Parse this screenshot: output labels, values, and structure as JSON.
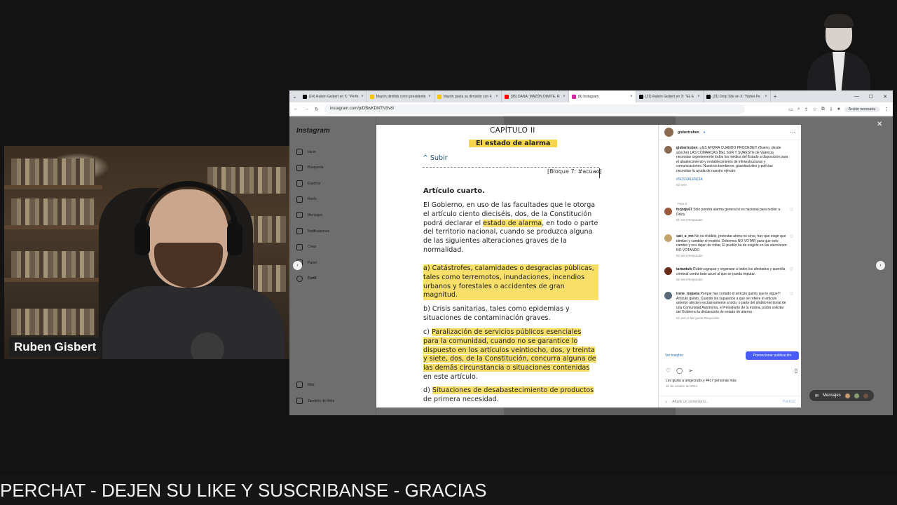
{
  "webcam": {
    "name": "Ruben Gisbert"
  },
  "ticker": {
    "text": "PERCHAT - DEJEN SU LIKE Y SUSCRIBANSE - GRACIAS"
  },
  "browser": {
    "tabs": [
      {
        "label": "(14) Rubén Gisbert en X: \"Perfe",
        "color": "#000000",
        "icon": "x-icon"
      },
      {
        "label": "Mazón dimitirá como presidente",
        "color": "#f5c400",
        "icon": "news-icon"
      },
      {
        "label": "Mazón pacta su dimisión con F",
        "color": "#f5c400",
        "icon": "news-icon"
      },
      {
        "label": "(95) DANA: MAZÓN DIMITE. R",
        "color": "#ff0000",
        "icon": "youtube-icon"
      },
      {
        "label": "(8) Instagram",
        "color": "#d6249f",
        "icon": "instagram-icon"
      },
      {
        "label": "(21) Rubén Gisbert en X: \"EL E",
        "color": "#000000",
        "icon": "x-icon"
      },
      {
        "label": "(21) Drop Site en X: \"Nobel Pe",
        "color": "#000000",
        "icon": "x-icon"
      }
    ],
    "active_tab": 4,
    "url": "instagram.com/p/DBwKDNTNSv8/",
    "accion": "Acción necesaria"
  },
  "instagram": {
    "logo": "Instagram",
    "nav": [
      {
        "label": "Inicio",
        "icon": "home-icon"
      },
      {
        "label": "Búsqueda",
        "icon": "search-icon"
      },
      {
        "label": "Explorar",
        "icon": "compass-icon"
      },
      {
        "label": "Reels",
        "icon": "reels-icon"
      },
      {
        "label": "Mensajes",
        "icon": "messenger-icon"
      },
      {
        "label": "Notificaciones",
        "icon": "heart-icon"
      },
      {
        "label": "Crear",
        "icon": "plus-icon"
      },
      {
        "label": "Panel",
        "icon": "chart-icon"
      },
      {
        "label": "Perfil",
        "icon": "avatar-icon"
      }
    ],
    "nav_bottom": [
      {
        "label": "Más",
        "icon": "menu-icon"
      },
      {
        "label": "También de Meta",
        "icon": "meta-icon"
      }
    ],
    "messages_pill": "Mensajes"
  },
  "document": {
    "chapter": "CAPÍTULO II",
    "section_title": "El estado de alarma",
    "subir": "Subir",
    "bloque": "[Bloque 7: #acuao]",
    "article": "Artículo cuarto.",
    "intro_before": "El Gobierno, en uso de las facultades que le otorga el artículo ciento dieciséis, dos, de la Constitución podrá declarar el ",
    "intro_highlight": "estado de alarma",
    "intro_after": ", en todo o parte del territorio nacional, cuando se produzca alguna de las siguientes alteraciones graves de la normalidad.",
    "a": "a) Catástrofes, calamidades o desgracias públicas, tales como terremotos, inundaciones, incendios urbanos y forestales o accidentes de gran magnitud.",
    "b": "b) Crisis sanitarias, tales como epidemias y situaciones de contaminación graves.",
    "c_before": "c) ",
    "c_highlight": "Paralización de servicios públicos esenciales para la comunidad, cuando no se garantice lo dispuesto en los artículos veintiocho, dos, y treinta y siete, dos, de la Constitución, concurra alguna de las demás circunstancia o situaciones contenidas",
    "c_after": " en este artículo.",
    "d_before": "d) ",
    "d_highlight": "Situaciones de desabastecimiento de productos",
    "d_after": " de primera necesidad."
  },
  "post": {
    "author": "gisbertruben",
    "caption_user": "gisbertruben",
    "caption": "¡¡¡ES AHORA CUANDO PROCEDE!!! (Bueno, desde anoche) LAS COMARCAS DEL SUR Y SURESTE de Valencia necesitan urgentemente todos los medios del Estado a disposición para el abastecimiento y restablecimiento de infraestructuras y comunicaciones. Nuestros bomberos, guardiaciviles y policías necesitan la ayuda de nuestro ejército.",
    "hashtag": "#SOSVALENCIA",
    "caption_meta": "52 sem",
    "translate": "Para ti",
    "comments": [
      {
        "user": "ferjorju67",
        "text": "Sólo pondrá alarma general si es nacional para recibir a Delcy",
        "meta": "51 sem  Responder"
      },
      {
        "user": "sari_a_mn",
        "text": "No os olvidéis, protestar ahora no sirve, hay que exigir que dimitan y cambiar el modelo. Debemos NO VOTAR para que esto cambie y nos dejen de robar. El pueblo ha de exigirlo en las elecciones NO VOTANDO",
        "meta": "52 sem  Responder"
      },
      {
        "user": "tartantule",
        "text": "Rubén agrupar y organizar a todos los afectados y querella criminal contra todo acuel al que se pueda imputar.",
        "meta": "52 sem  Responder"
      },
      {
        "user": "irene_roqueta",
        "text": "Porque has cortado el artículo quinto que le sigue?!  Artículo quinto.  Cuando los supuestos a que se refiere el artículo anterior afecten exclusivamente a todo, o parte del ámbito territorial de una Comunidad Autónoma, el Presidente de la misma, podrá solicitar del Gobierno la declaración de estado de alarma",
        "meta": "52 sem  8 Me gusta  Responder"
      }
    ],
    "insights": "Ver insights",
    "promote": "Promocionar publicación",
    "likes": "Les gusta a amgvcruds y 4417 personas más",
    "date": "30 de octubre de 2024",
    "add_comment": "Añade un comentario...",
    "publish": "Publicar"
  }
}
